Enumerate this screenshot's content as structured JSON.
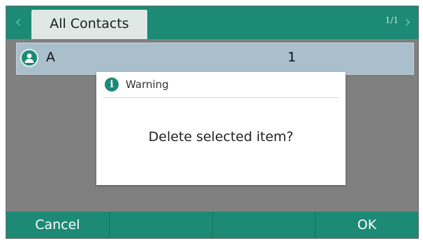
{
  "header": {
    "tab_label": "All Contacts",
    "page_counter": "1/1",
    "nav_left_icon": "chevron-left-icon",
    "nav_right_icon": "chevron-right-icon"
  },
  "contact": {
    "name": "A",
    "number": "1",
    "icon": "contact-avatar-icon"
  },
  "dialog": {
    "title": "Warning",
    "icon": "info-icon",
    "message": "Delete selected item?"
  },
  "softkeys": [
    {
      "label": "Cancel"
    },
    {
      "label": ""
    },
    {
      "label": ""
    },
    {
      "label": "OK"
    }
  ],
  "colors": {
    "accent": "#1c8a74",
    "selected_row": "#a9c0cc",
    "tab_bg": "#dfe8e5",
    "background": "#808080"
  }
}
